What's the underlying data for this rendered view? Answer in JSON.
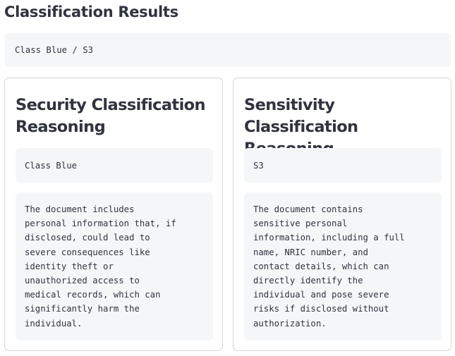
{
  "page": {
    "title": "Classification Results"
  },
  "summary": {
    "value": "Class Blue / S3"
  },
  "cards": [
    {
      "heading_line1": "Security Classification",
      "heading_line2": "Reasoning",
      "value": "Class Blue",
      "reasoning": "The document includes\npersonal information that, if\ndisclosed, could lead to\nsevere consequences like\nidentity theft or\nunauthorized access to\nmedical records, which can\nsignificantly harm the\nindividual."
    },
    {
      "heading_line1": "Sensitivity Classification",
      "heading_line2": "Reasoning",
      "value": "S3",
      "reasoning": "The document contains\nsensitive personal\ninformation, including a full\nname, NRIC number, and\ncontact details, which can\ndirectly identify the\nindividual and pose severe\nrisks if disclosed without\nauthorization."
    }
  ],
  "colors": {
    "text": "#31333f",
    "code_background": "#f5f6f8",
    "card_border": "#d6d6d9"
  }
}
